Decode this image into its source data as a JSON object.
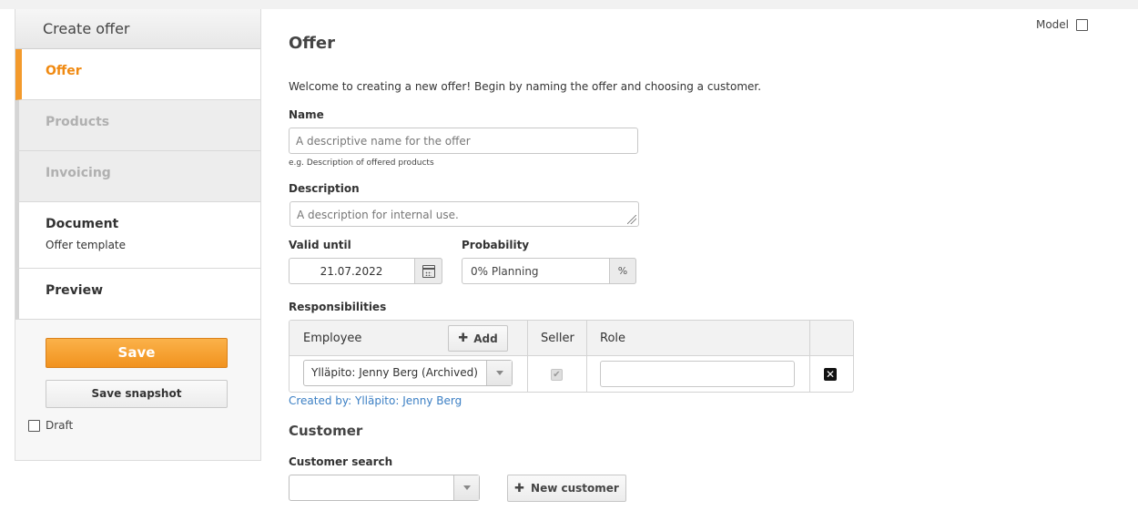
{
  "sidebar": {
    "header": "Create offer",
    "items": [
      {
        "label": "Offer"
      },
      {
        "label": "Products"
      },
      {
        "label": "Invoicing"
      },
      {
        "label": "Document",
        "sub": "Offer template"
      },
      {
        "label": "Preview"
      }
    ],
    "save_label": "Save",
    "snapshot_label": "Save snapshot",
    "draft_label": "Draft"
  },
  "main": {
    "model_label": "Model",
    "title": "Offer",
    "intro": "Welcome to creating a new offer! Begin by naming the offer and choosing a customer.",
    "name_label": "Name",
    "name_placeholder": "A descriptive name for the offer",
    "name_hint": "e.g. Description of offered products",
    "description_label": "Description",
    "description_placeholder": "A description for internal use.",
    "valid_until_label": "Valid until",
    "valid_until_value": "21.07.2022",
    "probability_label": "Probability",
    "probability_value": "0% Planning",
    "probability_unit": "%",
    "responsibilities_label": "Responsibilities",
    "table": {
      "col_employee": "Employee",
      "add_label": "Add",
      "col_seller": "Seller",
      "col_role": "Role",
      "row": {
        "employee": "Ylläpito: Jenny Berg (Archived)",
        "seller_checked": true,
        "role": ""
      }
    },
    "created_by": "Created by: Ylläpito: Jenny Berg",
    "customer_heading": "Customer",
    "customer_search_label": "Customer search",
    "customer_search_value": "",
    "new_customer_label": "New customer"
  },
  "colors": {
    "accent": "#f39a2c",
    "link": "#3b7fc4"
  }
}
